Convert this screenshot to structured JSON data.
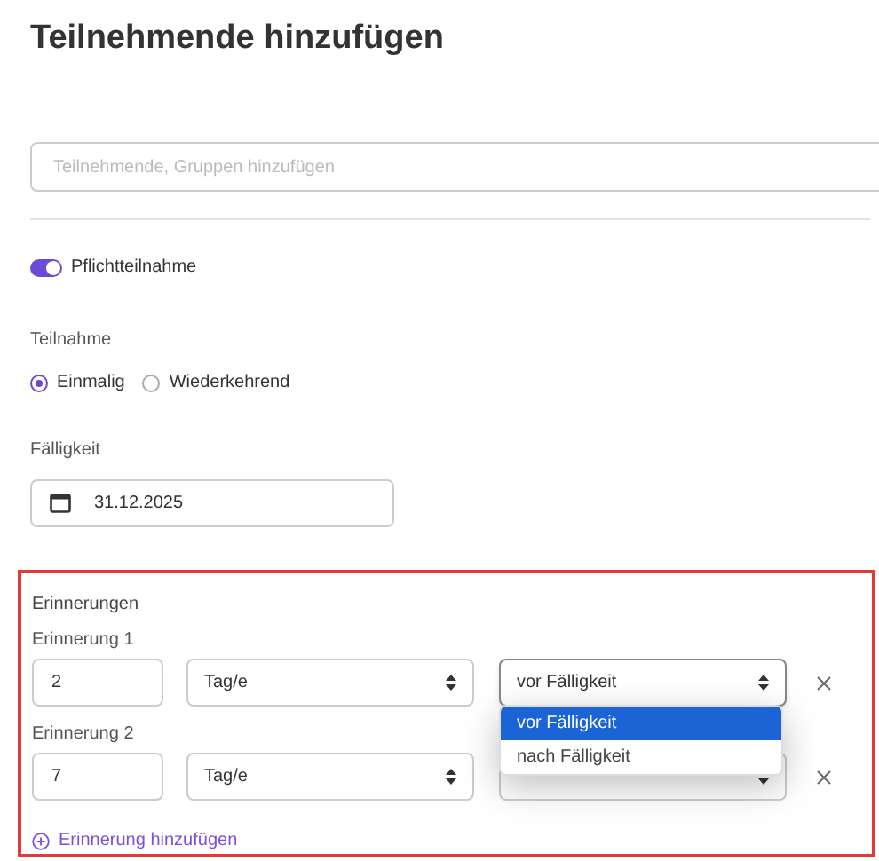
{
  "title": "Teilnehmende hinzufügen",
  "participants_field": {
    "placeholder": "Teilnehmende, Gruppen hinzufügen"
  },
  "mandatory": {
    "label": "Pflichtteilnahme",
    "on": true
  },
  "participation": {
    "label": "Teilnahme",
    "options": [
      {
        "label": "Einmalig",
        "selected": true
      },
      {
        "label": "Wiederkehrend",
        "selected": false
      }
    ]
  },
  "due": {
    "label": "Fälligkeit",
    "value": "31.12.2025"
  },
  "reminders": {
    "label": "Erinnerungen",
    "items": [
      {
        "label": "Erinnerung 1",
        "amount": "2",
        "unit": "Tag/e",
        "relation": "vor Fälligkeit",
        "open": true,
        "options": [
          {
            "label": "vor Fälligkeit",
            "selected": true
          },
          {
            "label": "nach Fälligkeit",
            "selected": false
          }
        ]
      },
      {
        "label": "Erinnerung 2",
        "amount": "7",
        "unit": "Tag/e",
        "open": false
      }
    ],
    "add_label": "Erinnerung hinzufügen"
  }
}
